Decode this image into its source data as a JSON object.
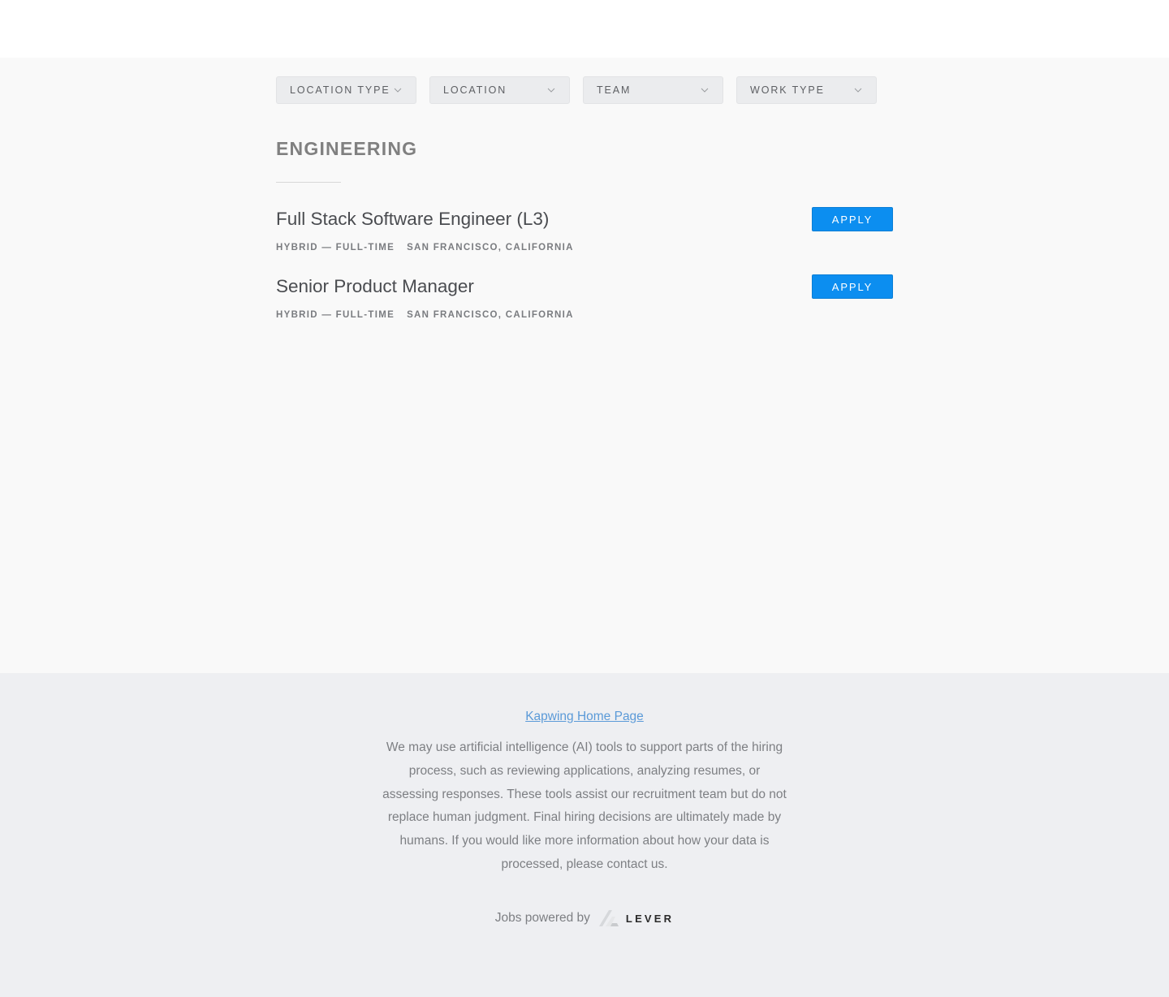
{
  "filters": [
    {
      "label": "Location type"
    },
    {
      "label": "Location"
    },
    {
      "label": "Team"
    },
    {
      "label": "Work type"
    }
  ],
  "section": {
    "title": "Engineering"
  },
  "postings": [
    {
      "title": "Full Stack Software Engineer (L3)",
      "commitment": "Hybrid — Full-time",
      "location": "San Francisco, California",
      "apply_label": "Apply"
    },
    {
      "title": "Senior Product Manager",
      "commitment": "Hybrid — Full-time",
      "location": "San Francisco, California",
      "apply_label": "Apply"
    }
  ],
  "footer": {
    "home_link": "Kapwing Home Page",
    "disclaimer": "We may use artificial intelligence (AI) tools to support parts of the hiring process, such as reviewing applications, analyzing resumes, or assessing responses. These tools assist our recruitment team but do not replace human judgment. Final hiring decisions are ultimately made by humans. If you would like more information about how your data is processed, please contact us.",
    "powered_by": "Jobs powered by",
    "brand": "LEVER"
  },
  "colors": {
    "apply_button": "#0c8ef0",
    "link": "#5b9ad8",
    "footer_bg": "#eeeff2"
  },
  "icons": {
    "filter_chevron": "chevron-down-icon",
    "brand_logo": "lever-logo-icon"
  }
}
